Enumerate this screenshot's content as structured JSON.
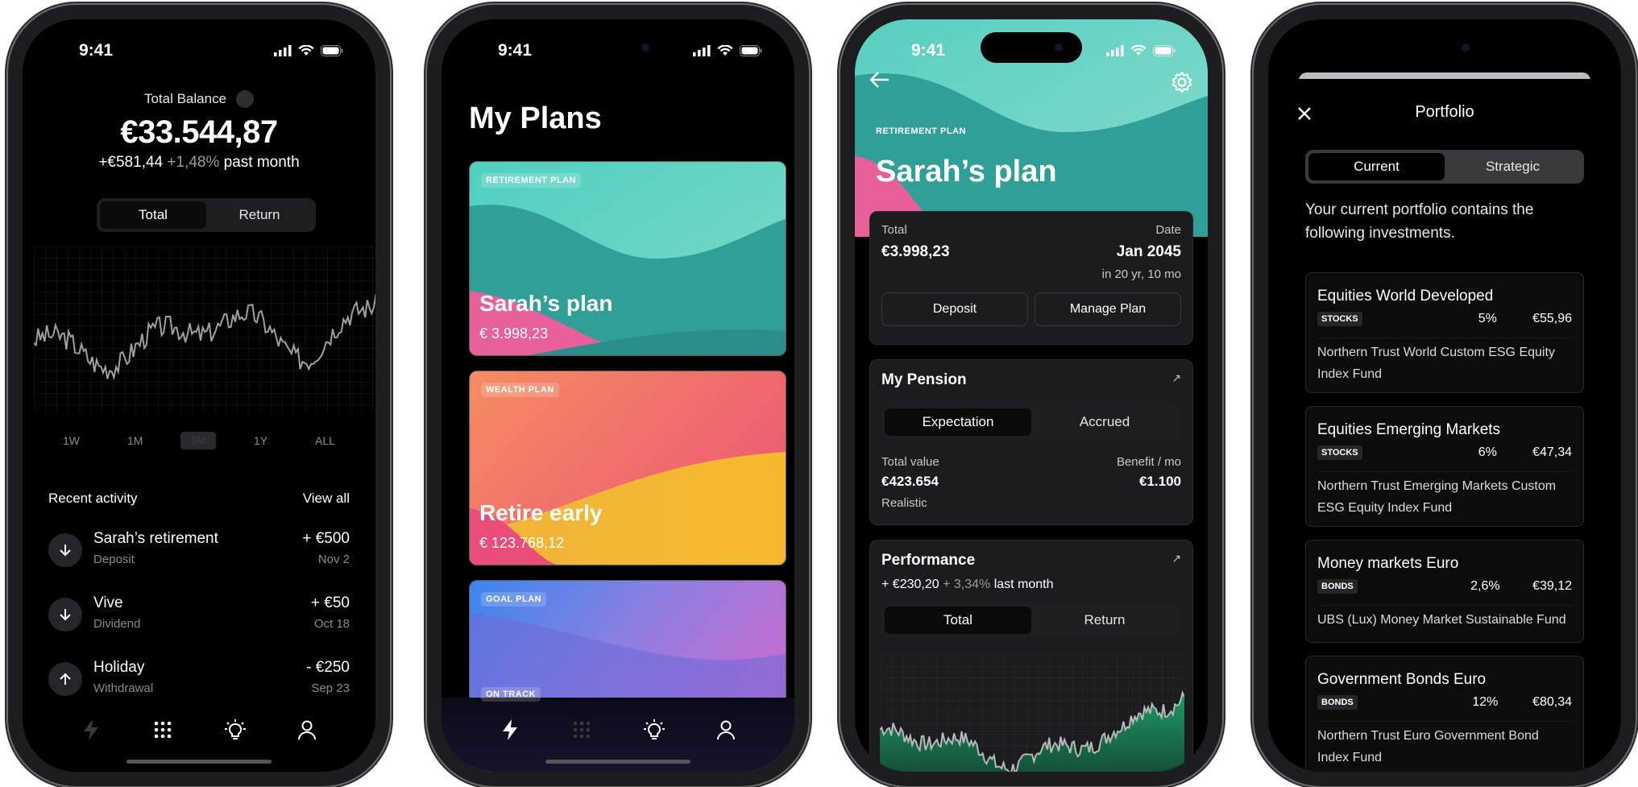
{
  "status_time": "9:41",
  "colors": {
    "accent_chart_fill": "#1f7a55",
    "background": "#000000",
    "card": "#1c1c1e"
  },
  "phone1": {
    "balance_label": "Total Balance",
    "balance": "€33.544,87",
    "change_abs": "+€581,44",
    "change_pct": "+1,48%",
    "change_period": "past month",
    "segment": [
      "Total",
      "Return"
    ],
    "ranges": [
      "1W",
      "1M",
      "3M",
      "1Y",
      "ALL"
    ],
    "recent_title": "Recent activity",
    "view_all": "View all",
    "activities": [
      {
        "name": "Sarah’s retirement",
        "type": "Deposit",
        "amount": "+ €500",
        "date": "Nov 2",
        "icon": "arrow-down-icon"
      },
      {
        "name": "Vive",
        "type": "Dividend",
        "amount": "+ €50",
        "date": "Oct 18",
        "icon": "arrow-down-icon"
      },
      {
        "name": "Holiday",
        "type": "Withdrawal",
        "amount": "- €250",
        "date": "Sep 23",
        "icon": "arrow-up-icon"
      }
    ]
  },
  "phone2": {
    "title": "My Plans",
    "plans": [
      {
        "kind": "RETIREMENT PLAN",
        "name": "Sarah’s plan",
        "amount": "€ 3.998,23"
      },
      {
        "kind": "WEALTH PLAN",
        "name": "Retire early",
        "amount": "€ 123.768,12"
      },
      {
        "kind": "GOAL PLAN",
        "name": "",
        "amount": ""
      }
    ],
    "peek_label": "ON TRACK"
  },
  "phone3": {
    "kind": "RETIREMENT PLAN",
    "name": "Sarah’s plan",
    "total_label": "Total",
    "total": "€3.998,23",
    "date_label": "Date",
    "date": "Jan 2045",
    "date_sub": "in 20 yr, 10 mo",
    "deposit": "Deposit",
    "manage": "Manage Plan",
    "pension_title": "My Pension",
    "pension_seg": [
      "Expectation",
      "Accrued"
    ],
    "total_value_label": "Total value",
    "total_value": "€423.654",
    "benefit_label": "Benefit / mo",
    "benefit": "€1.100",
    "scenario": "Realistic",
    "perf_title": "Performance",
    "perf_abs": "+ €230,20",
    "perf_pct": "+ 3,34%",
    "perf_period": "last month",
    "perf_seg": [
      "Total",
      "Return"
    ]
  },
  "phone4": {
    "title": "Portfolio",
    "seg": [
      "Current",
      "Strategic"
    ],
    "desc": "Your current portfolio contains the following investments.",
    "investments": [
      {
        "name": "Equities World Developed",
        "badge": "STOCKS",
        "pct": "5%",
        "value": "€55,96",
        "fund": "Northern Trust World Custom ESG Equity Index Fund"
      },
      {
        "name": "Equities Emerging Markets",
        "badge": "STOCKS",
        "pct": "6%",
        "value": "€47,34",
        "fund": "Northern Trust Emerging Markets Custom ESG Equity Index Fund"
      },
      {
        "name": "Money markets Euro",
        "badge": "BONDS",
        "pct": "2,6%",
        "value": "€39,12",
        "fund": "UBS (Lux) Money Market Sustainable Fund"
      },
      {
        "name": "Government Bonds Euro",
        "badge": "BONDS",
        "pct": "12%",
        "value": "€80,34",
        "fund": "Northern Trust Euro Government Bond Index Fund"
      }
    ]
  }
}
